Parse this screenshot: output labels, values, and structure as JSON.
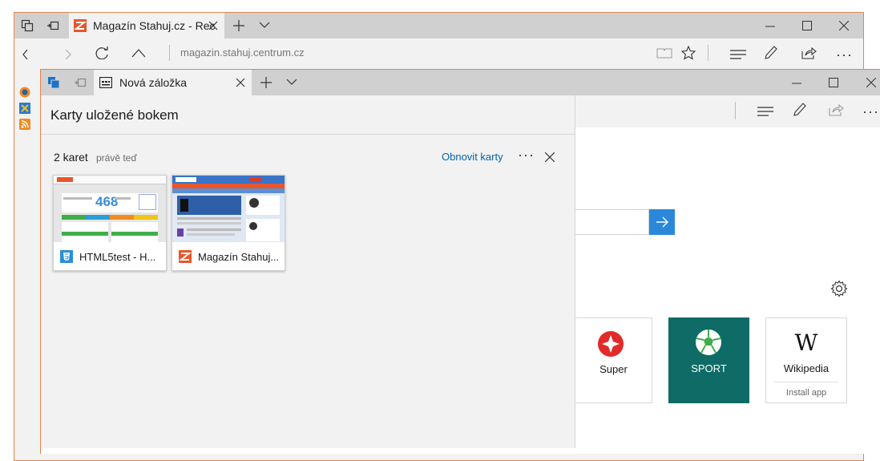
{
  "back_window": {
    "tab_title": "Magazín Stahuj.cz - Rec",
    "address_text": "magazin.stahuj.centrum.cz"
  },
  "front_window": {
    "tab_title": "Nová záložka"
  },
  "set_aside_panel": {
    "title": "Karty uložené bokem",
    "group": {
      "count_label": "2 karet",
      "time_label": "právě teď",
      "restore_label": "Obnovit karty",
      "more_label": "···"
    },
    "cards": [
      {
        "title": "HTML5test - H...",
        "thumb_number": "468"
      },
      {
        "title": "Magazín Stahuj..."
      }
    ]
  },
  "new_tab_page": {
    "tiles": [
      {
        "label": "Super"
      },
      {
        "label": "SPORT"
      },
      {
        "label": "Wikipedia",
        "sub_label": "Install app",
        "glyph": "W"
      }
    ]
  },
  "colors": {
    "accent_border": "#e8834a",
    "link_blue": "#0063b1",
    "search_blue": "#2b88d8",
    "sport_tile": "#0e6b66",
    "super_red": "#e22a2a"
  },
  "icons": [
    "tabs-aside-icon",
    "set-aside-icon",
    "close-icon",
    "new-tab-icon",
    "chevron-down-icon",
    "minimize-icon",
    "maximize-icon",
    "hub-icon",
    "notes-icon",
    "share-icon",
    "more-icon",
    "settings-gear-icon",
    "search-arrow-icon",
    "html5-icon",
    "stahuj-logo-icon"
  ]
}
